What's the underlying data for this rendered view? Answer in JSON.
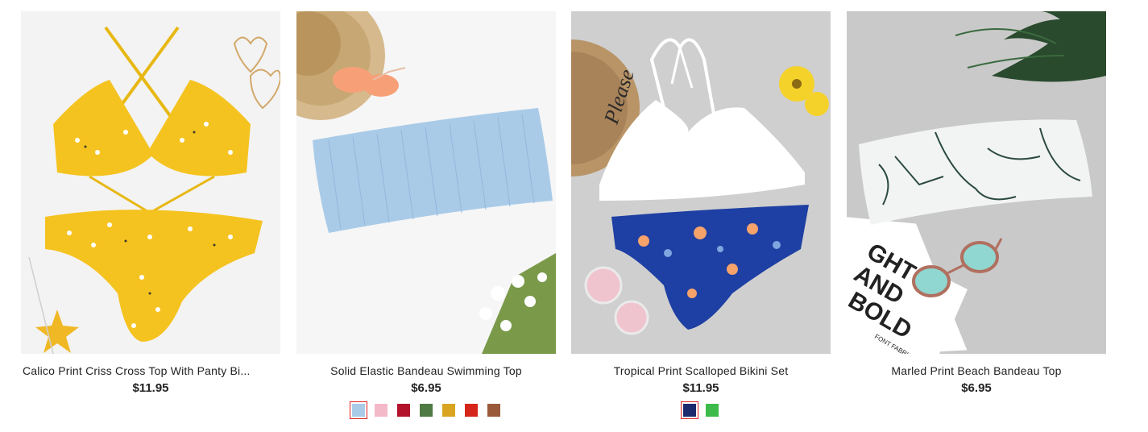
{
  "products": [
    {
      "title": "Calico Print Criss Cross Top With Panty Bi...",
      "price": "$11.95",
      "swatches": []
    },
    {
      "title": "Solid Elastic Bandeau Swimming Top",
      "price": "$6.95",
      "swatches": [
        {
          "color": "#a9cbe8",
          "selected": true
        },
        {
          "color": "#f4b9c9",
          "selected": false
        },
        {
          "color": "#b3142b",
          "selected": false
        },
        {
          "color": "#4f7a43",
          "selected": false
        },
        {
          "color": "#d9a521",
          "selected": false
        },
        {
          "color": "#d6261b",
          "selected": false
        },
        {
          "color": "#9a5a3a",
          "selected": false
        }
      ]
    },
    {
      "title": "Tropical Print Scalloped Bikini Set",
      "price": "$11.95",
      "swatches": [
        {
          "color": "#1e2a6e",
          "selected": true
        },
        {
          "color": "#3dbb4a",
          "selected": false
        }
      ]
    },
    {
      "title": "Marled Print Beach Bandeau Top",
      "price": "$6.95",
      "swatches": []
    }
  ],
  "image_texts": {
    "hat_text": "Please",
    "card_line1": "GHT",
    "card_line2": "AND",
    "card_line3": "BOLD",
    "card_brand": "FONT FABRIC"
  }
}
